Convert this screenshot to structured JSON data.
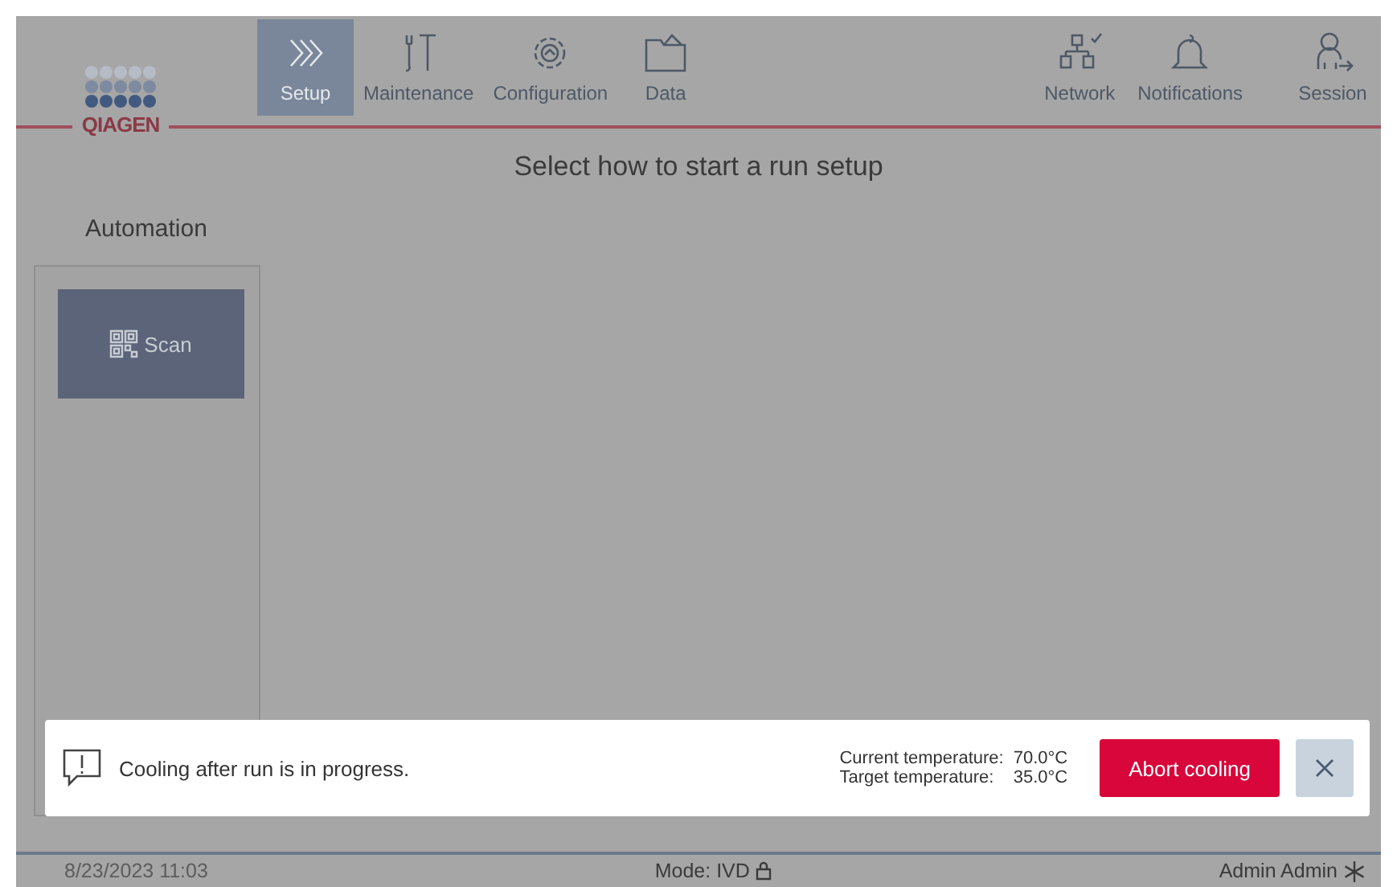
{
  "header": {
    "logo": "QIAGEN",
    "nav": [
      {
        "label": "Setup",
        "selected": true
      },
      {
        "label": "Maintenance",
        "selected": false
      },
      {
        "label": "Configuration",
        "selected": false
      },
      {
        "label": "Data",
        "selected": false
      }
    ],
    "right": [
      {
        "label": "Network"
      },
      {
        "label": "Notifications"
      },
      {
        "label": "Session"
      }
    ]
  },
  "title": "Select how to start a run setup",
  "sidebar": {
    "heading": "Automation",
    "buttons": [
      {
        "label": "Scan"
      }
    ]
  },
  "notification": {
    "message": "Cooling after run is in progress.",
    "readings": [
      {
        "label": "Current temperature:",
        "value": "70.0°C"
      },
      {
        "label": "Target temperature:",
        "value": "35.0°C"
      }
    ],
    "action": "Abort cooling"
  },
  "status_bar": {
    "datetime": "8/23/2023 11:03",
    "mode": "Mode: IVD",
    "user": "Admin Admin"
  }
}
